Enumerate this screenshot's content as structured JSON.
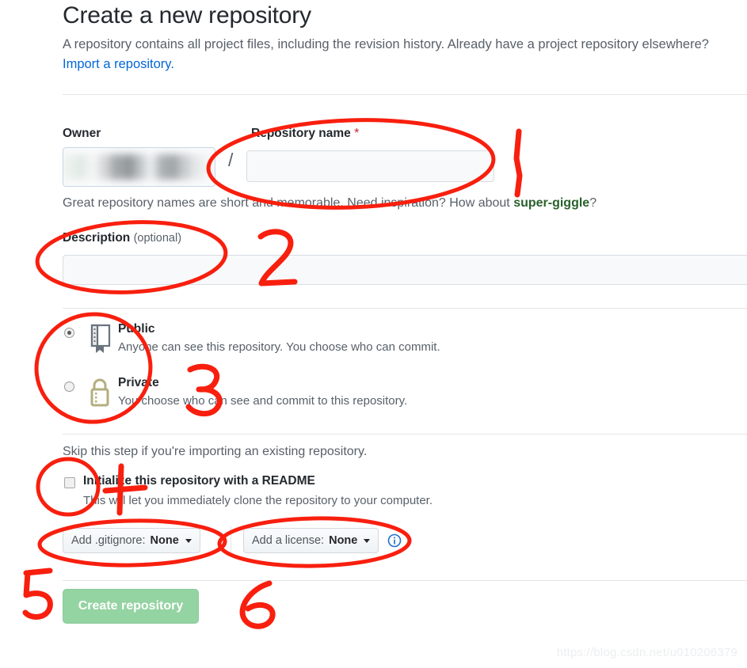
{
  "page": {
    "title": "Create a new repository",
    "subtitle": "A repository contains all project files, including the revision history. Already have a project repository elsewhere?",
    "import_link": "Import a repository.",
    "watermark": "https://blog.csdn.net/u010206379"
  },
  "owner": {
    "label": "Owner",
    "value_redacted": true,
    "separator": "/"
  },
  "repo_name": {
    "label": "Repository name",
    "required_mark": "*",
    "value": "",
    "placeholder": ""
  },
  "helper": {
    "prefix": "Great repository names are short and memorable. Need inspiration? How about ",
    "suggestion": "super-giggle",
    "suffix": "?"
  },
  "description": {
    "label": "Description",
    "optional_label": "(optional)",
    "value": "",
    "placeholder": ""
  },
  "visibility": {
    "options": [
      {
        "id": "public",
        "title": "Public",
        "description": "Anyone can see this repository. You choose who can commit.",
        "icon": "repo-book-icon",
        "selected": true
      },
      {
        "id": "private",
        "title": "Private",
        "description": "You choose who can see and commit to this repository.",
        "icon": "lock-icon",
        "selected": false
      }
    ]
  },
  "readme": {
    "skip_note": "Skip this step if you're importing an existing repository.",
    "checkbox_label": "Initialize this repository with a README",
    "checkbox_description": "This will let you immediately clone the repository to your computer.",
    "checked": false
  },
  "dropdowns": {
    "gitignore": {
      "label": "Add .gitignore:",
      "value": "None",
      "icon": "chevron-down-icon"
    },
    "license": {
      "label": "Add a license:",
      "value": "None",
      "icon": "chevron-down-icon"
    },
    "info_icon": "info-circle-icon"
  },
  "submit": {
    "label": "Create repository",
    "enabled": false,
    "color": "#94d3a2"
  },
  "annotations": {
    "color": "#f81f0e",
    "marks": [
      {
        "id": "1",
        "text": "1",
        "shape": "vertical-stroke",
        "target": "repository-name-field"
      },
      {
        "id": "2",
        "text": "2",
        "shape": "digit",
        "target": "description-field"
      },
      {
        "id": "3",
        "text": "3",
        "shape": "digit",
        "target": "visibility-options"
      },
      {
        "id": "4",
        "text": "4",
        "shape": "digit",
        "target": "readme-checkbox"
      },
      {
        "id": "5",
        "text": "5",
        "shape": "digit",
        "target": "create-repository-button"
      },
      {
        "id": "6",
        "text": "6",
        "shape": "digit",
        "target": "create-repository-button"
      }
    ],
    "ellipses": [
      "repository-name-ellipse",
      "description-ellipse",
      "visibility-ellipse",
      "readme-ellipse",
      "gitignore-ellipse",
      "license-ellipse"
    ]
  }
}
